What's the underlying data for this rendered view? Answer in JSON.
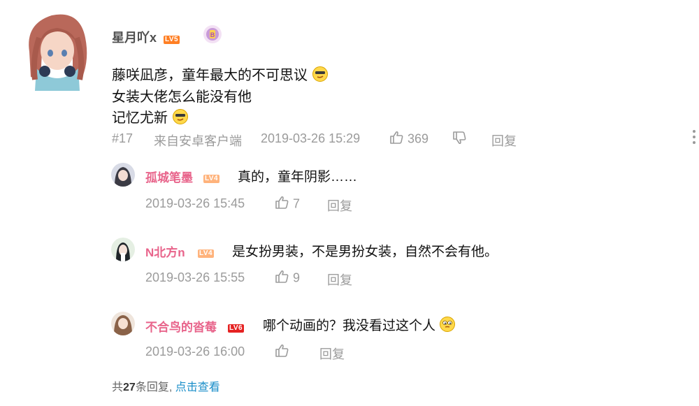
{
  "comment": {
    "username": "星月吖x",
    "level": "LV5",
    "lines": [
      "藤咲凪彦，童年最大的不可思议",
      "女装大佬怎么能没有他",
      "记忆尤新"
    ],
    "floor": "#17",
    "source": "来自安卓客户端",
    "time": "2019-03-26 15:29",
    "likes": "369",
    "reply_label": "回复"
  },
  "replies": [
    {
      "username": "孤城笔墨",
      "level": "LV4",
      "text": "真的，童年阴影……",
      "time": "2019-03-26 15:45",
      "likes": "7",
      "reply_label": "回复"
    },
    {
      "username": "N北方n",
      "level": "LV4",
      "text": "是女扮男装，不是男扮女装，自然不会有他。",
      "time": "2019-03-26 15:55",
      "likes": "9",
      "reply_label": "回复"
    },
    {
      "username": "不合鸟的沓莓",
      "level": "LV6",
      "text": "哪个动画的？我没看过这个人",
      "time": "2019-03-26 16:00",
      "likes": "",
      "reply_label": "回复"
    }
  ],
  "summary": {
    "prefix": "共",
    "count": "27",
    "suffix": "条回复,",
    "link": "点击查看"
  },
  "icons": {
    "like": "thumbs-up-icon",
    "dislike": "thumbs-down-icon",
    "more": "vertical-more-icon",
    "badge": "fan-badge-icon",
    "emoji_sunglasses": "sunglasses-emoji-icon",
    "emoji_sleepy": "sleepy-emoji-icon"
  },
  "colors": {
    "username_pink": "#e8648b",
    "level5": "#ff7f24",
    "level4": "#ffb37c",
    "level6": "#e52222",
    "link": "#1a8ec9",
    "meta_gray": "#9b9b9b"
  }
}
